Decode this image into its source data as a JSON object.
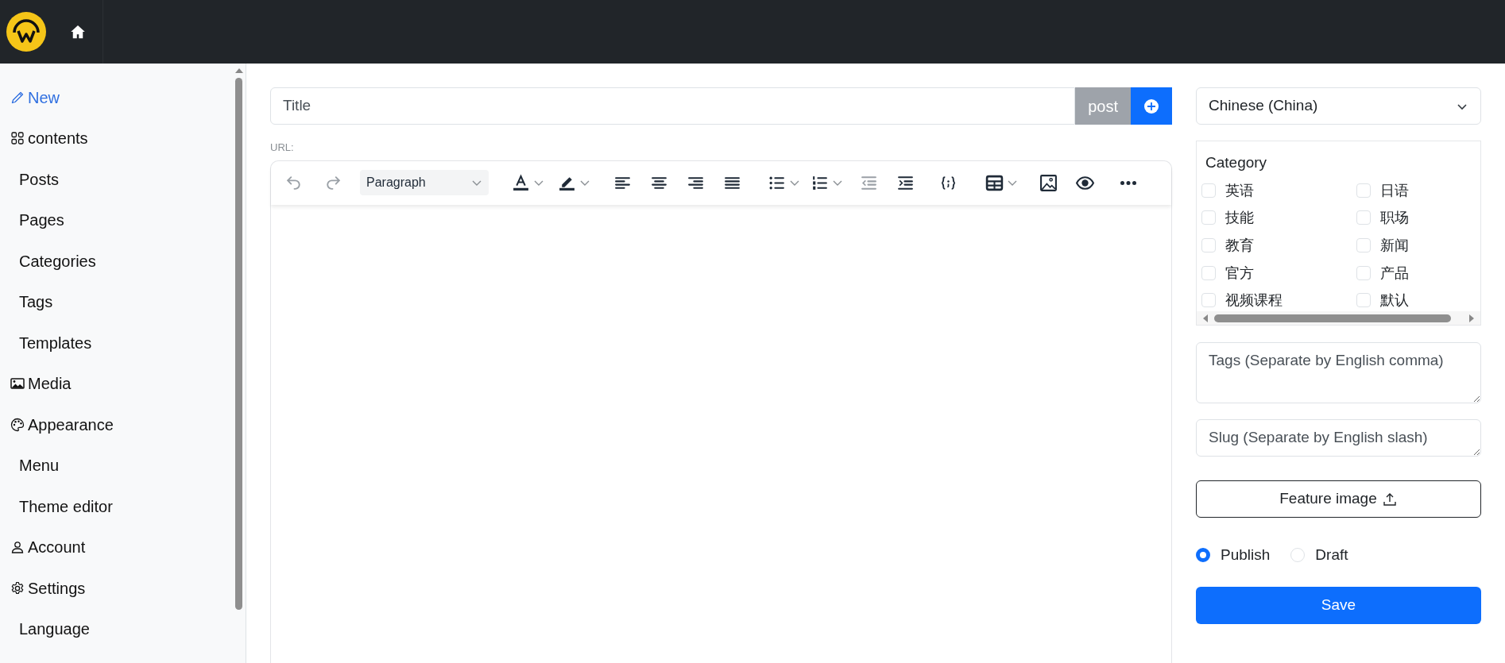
{
  "sidebar": {
    "items": [
      {
        "label": "New",
        "kind": "section",
        "selected": true
      },
      {
        "label": "contents",
        "kind": "section",
        "selected": false
      },
      {
        "label": "Posts",
        "kind": "link",
        "selected": false
      },
      {
        "label": "Pages",
        "kind": "link",
        "selected": false
      },
      {
        "label": "Categories",
        "kind": "link",
        "selected": false
      },
      {
        "label": "Tags",
        "kind": "link",
        "selected": false
      },
      {
        "label": "Templates",
        "kind": "link",
        "selected": false
      },
      {
        "label": "Media",
        "kind": "section",
        "selected": false
      },
      {
        "label": "Appearance",
        "kind": "section",
        "selected": false
      },
      {
        "label": "Menu",
        "kind": "link",
        "selected": false
      },
      {
        "label": "Theme editor",
        "kind": "link",
        "selected": false
      },
      {
        "label": "Account",
        "kind": "section",
        "selected": false
      },
      {
        "label": "Settings",
        "kind": "section",
        "selected": false
      },
      {
        "label": "Language",
        "kind": "link",
        "selected": false
      }
    ]
  },
  "title_field": {
    "placeholder": "Title",
    "type_label": "post"
  },
  "url_label": "URL:",
  "toolbar": {
    "buttons": [
      {
        "kind": "undo",
        "disabled": true
      },
      {
        "kind": "redo",
        "disabled": true
      },
      {
        "kind": "format",
        "label": "Paragraph",
        "disabled": false
      },
      {
        "kind": "text-color",
        "disabled": false
      },
      {
        "kind": "highlight",
        "disabled": false
      },
      {
        "kind": "align-left",
        "disabled": false
      },
      {
        "kind": "align-center",
        "disabled": false
      },
      {
        "kind": "align-right",
        "disabled": false
      },
      {
        "kind": "justify",
        "disabled": false
      },
      {
        "kind": "bullet-list",
        "disabled": false
      },
      {
        "kind": "numbered-list",
        "disabled": false
      },
      {
        "kind": "outdent",
        "disabled": true
      },
      {
        "kind": "indent",
        "disabled": false
      },
      {
        "kind": "code",
        "disabled": false
      },
      {
        "kind": "table",
        "disabled": false
      },
      {
        "kind": "image",
        "disabled": false
      },
      {
        "kind": "preview",
        "disabled": false
      },
      {
        "kind": "more",
        "disabled": false
      }
    ]
  },
  "language_select": {
    "value": "Chinese (China)"
  },
  "category": {
    "title": "Category",
    "options": [
      {
        "label": "英语",
        "checked": false
      },
      {
        "label": "日语",
        "checked": false
      },
      {
        "label": "技能",
        "checked": false
      },
      {
        "label": "职场",
        "checked": false
      },
      {
        "label": "教育",
        "checked": false
      },
      {
        "label": "新闻",
        "checked": false
      },
      {
        "label": "官方",
        "checked": false
      },
      {
        "label": "产品",
        "checked": false
      },
      {
        "label": "视频课程",
        "checked": false
      },
      {
        "label": "默认",
        "checked": false
      }
    ]
  },
  "tags_field": {
    "placeholder": "Tags (Separate by English comma)"
  },
  "slug_field": {
    "placeholder": "Slug (Separate by English slash)"
  },
  "feature_image_button": "Feature image",
  "status": [
    {
      "label": "Publish",
      "selected": true
    },
    {
      "label": "Draft",
      "selected": false
    }
  ],
  "save_button": "Save"
}
